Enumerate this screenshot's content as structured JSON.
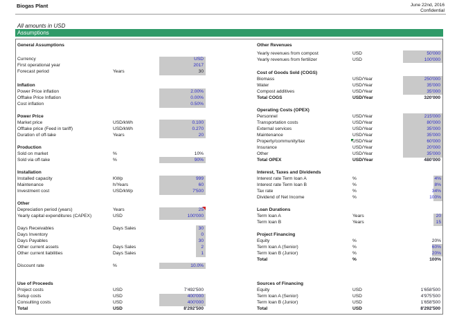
{
  "header": {
    "title": "Biogas Plant",
    "date": "June 22nd, 2016",
    "confidential": "Confidential"
  },
  "amounts_note": "All amounts in USD",
  "banner": "Assumptions",
  "left": {
    "general": {
      "title": "General Assumptions",
      "rows": [
        {
          "label": "Currency",
          "unit": "",
          "value": "USD"
        },
        {
          "label": "First operational year",
          "unit": "",
          "value": "2017"
        },
        {
          "label": "Forecast period",
          "unit": "Years",
          "value": "30"
        }
      ]
    },
    "inflation": {
      "title": "Inflation",
      "rows": [
        {
          "label": "Power Price inflation",
          "unit": "",
          "value": "2.00%"
        },
        {
          "label": "Offtake Price Inflation",
          "unit": "",
          "value": "0.00%"
        },
        {
          "label": "Cost inflation",
          "unit": "",
          "value": "0.50%"
        }
      ]
    },
    "power": {
      "title": "Power Price",
      "rows": [
        {
          "label": "Market price",
          "unit": "USD/kWh",
          "value": "0.100"
        },
        {
          "label": "Offtake price (Feed in tariff)",
          "unit": "USD/kWh",
          "value": "0.270"
        },
        {
          "label": "Duration of off-take",
          "unit": "Years",
          "value": "20"
        }
      ]
    },
    "production": {
      "title": "Production",
      "rows": [
        {
          "label": "Sold on market",
          "unit": "%",
          "value": "10%"
        },
        {
          "label": "Sold via off-take",
          "unit": "%",
          "value": "90%"
        }
      ]
    },
    "installation": {
      "title": "Installation",
      "rows": [
        {
          "label": "Installed capacity",
          "unit": "KWp",
          "value": "999"
        },
        {
          "label": "Maintenance",
          "unit": "h/Years",
          "value": "60"
        },
        {
          "label": "Investment cost",
          "unit": "USD/kWp",
          "value": "7'500"
        }
      ]
    },
    "other": {
      "title": "Other",
      "rows": [
        {
          "label": "Depreciation period (years)",
          "unit": "Years",
          "value": "25"
        },
        {
          "label": "Yearly capital expenditures (CAPEX)",
          "unit": "USD",
          "value": "100'000"
        }
      ]
    },
    "working_capital": {
      "rows": [
        {
          "label": "Days Receivables",
          "unit": "Days Sales",
          "value": "30"
        },
        {
          "label": "Days Inventory",
          "unit": "",
          "value": "0"
        },
        {
          "label": "Days Payables",
          "unit": "",
          "value": "30"
        },
        {
          "label": "Other current assets",
          "unit": "Days Sales",
          "value": "2"
        },
        {
          "label": "Other current liabilities",
          "unit": "Days Sales",
          "value": "1"
        }
      ]
    },
    "discount": {
      "label": "Discount rate",
      "unit": "%",
      "value": "10.0%"
    },
    "uses": {
      "title": "Use of Proceeds",
      "rows": [
        {
          "label": "Project costs",
          "unit": "USD",
          "value": "7'492'500"
        },
        {
          "label": "Setup costs",
          "unit": "USD",
          "value": "400'000"
        },
        {
          "label": "Consulting costs",
          "unit": "USD",
          "value": "400'000"
        }
      ],
      "total": {
        "label": "Total",
        "unit": "USD",
        "value": "8'292'500"
      }
    }
  },
  "right": {
    "other_revenues": {
      "title": "Other Revenues",
      "rows": [
        {
          "label": "Yearly revenues from compost",
          "unit": "USD",
          "value": "50'000"
        },
        {
          "label": "Yearly revenues from fertilizer",
          "unit": "USD",
          "value": "100'000"
        }
      ]
    },
    "cogs": {
      "title": "Cost of Goods Sold (COGS)",
      "rows": [
        {
          "label": "Biomass",
          "unit": "USD/Year",
          "value": "250'000"
        },
        {
          "label": "Water",
          "unit": "USD/Year",
          "value": "35'000"
        },
        {
          "label": "Compost additives",
          "unit": "USD/Year",
          "value": "35'000"
        }
      ],
      "total": {
        "label": "Total COGS",
        "unit": "USD/Year",
        "value": "320'000"
      }
    },
    "opex": {
      "title": "Operating Costs (OPEX)",
      "rows": [
        {
          "label": "Personnel",
          "unit": "USD/Year",
          "value": "215'000"
        },
        {
          "label": "Transportation costs",
          "unit": "USD/Year",
          "value": "80'000"
        },
        {
          "label": "External services",
          "unit": "USD/Year",
          "value": "35'000"
        },
        {
          "label": "Maintenance",
          "unit": "USD/Year",
          "value": "35'000"
        },
        {
          "label": "Property/community/tax",
          "unit": "USD/Year",
          "value": "60'000"
        },
        {
          "label": "Insurance",
          "unit": "USD/Year",
          "value": "20'000"
        },
        {
          "label": "Other",
          "unit": "USD/Year",
          "value": "35'000"
        }
      ],
      "total": {
        "label": "Total OPEX",
        "unit": "USD/Year",
        "value": "480'000"
      }
    },
    "interest": {
      "title": "Interest, Taxes and Dividends",
      "rows": [
        {
          "label": "Interest rate Term loan A",
          "unit": "%",
          "value": "4%"
        },
        {
          "label": "Interest rate Term loan B",
          "unit": "%",
          "value": "8%"
        },
        {
          "label": "Tax rate",
          "unit": "%",
          "value": "34%"
        },
        {
          "label": "Dividend of Net Income",
          "unit": "%",
          "value": "100%"
        }
      ]
    },
    "loans": {
      "title": "Loan Durations",
      "rows": [
        {
          "label": "Term loan A",
          "unit": "Years",
          "value": "20"
        },
        {
          "label": "Term loan B",
          "unit": "Years",
          "value": "15"
        }
      ]
    },
    "financing": {
      "title": "Project Financing",
      "rows": [
        {
          "label": "Equity",
          "unit": "%",
          "value": "20%"
        },
        {
          "label": "Term loan A (Senior)",
          "unit": "%",
          "value": "60%"
        },
        {
          "label": "Term loan B (Junior)",
          "unit": "%",
          "value": "20%"
        }
      ],
      "total": {
        "label": "Total",
        "unit": "%",
        "value": "100%"
      }
    },
    "sources": {
      "title": "Sources of Financing",
      "rows": [
        {
          "label": "Equity",
          "unit": "USD",
          "value": "1'658'500"
        },
        {
          "label": "Term loan A (Senior)",
          "unit": "USD",
          "value": "4'975'500"
        },
        {
          "label": "Term loan B (Junior)",
          "unit": "USD",
          "value": "1'658'500"
        }
      ],
      "total": {
        "label": "Total",
        "unit": "USD",
        "value": "8'292'500"
      }
    }
  }
}
